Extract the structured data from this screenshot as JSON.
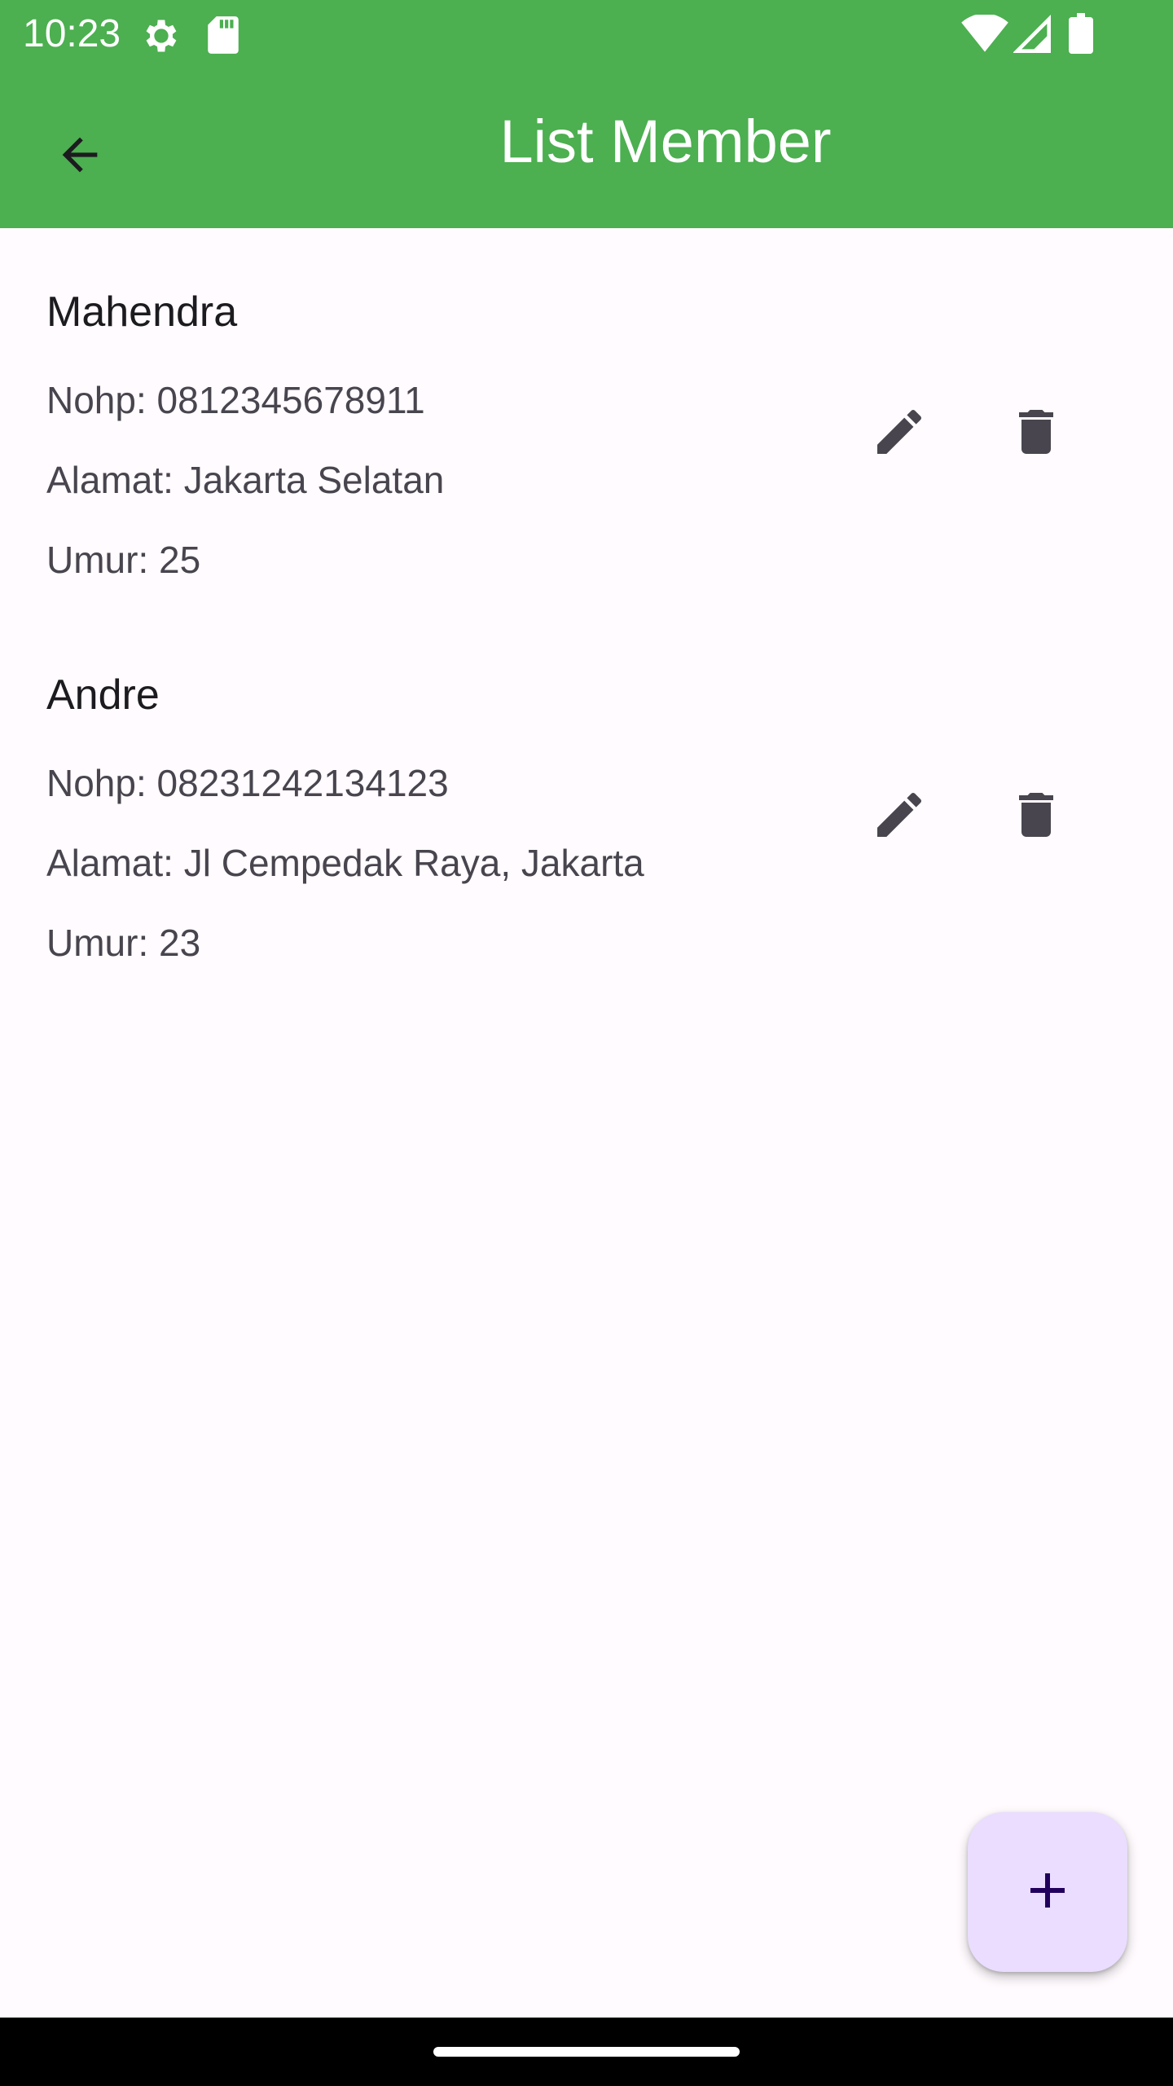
{
  "status_bar": {
    "time": "10:23",
    "icons": [
      "settings-gear-icon",
      "sd-card-icon",
      "wifi-icon",
      "signal-icon",
      "battery-icon"
    ]
  },
  "app_bar": {
    "title": "List Member",
    "back_icon": "arrow-back-icon",
    "background_color": "#4caf50"
  },
  "members": [
    {
      "name": "Mahendra",
      "nohp": "Nohp: 0812345678911",
      "alamat": "Alamat: Jakarta Selatan",
      "umur": "Umur: 25"
    },
    {
      "name": "Andre",
      "nohp": "Nohp: 08231242134123",
      "alamat": "Alamat: Jl Cempedak Raya, Jakarta",
      "umur": "Umur: 23"
    }
  ],
  "actions": {
    "edit_icon": "pencil-edit-icon",
    "delete_icon": "trash-delete-icon",
    "icon_color": "#49454f"
  },
  "fab": {
    "icon": "plus-add-icon",
    "background_color": "#eaddff",
    "icon_color": "#21005d"
  }
}
